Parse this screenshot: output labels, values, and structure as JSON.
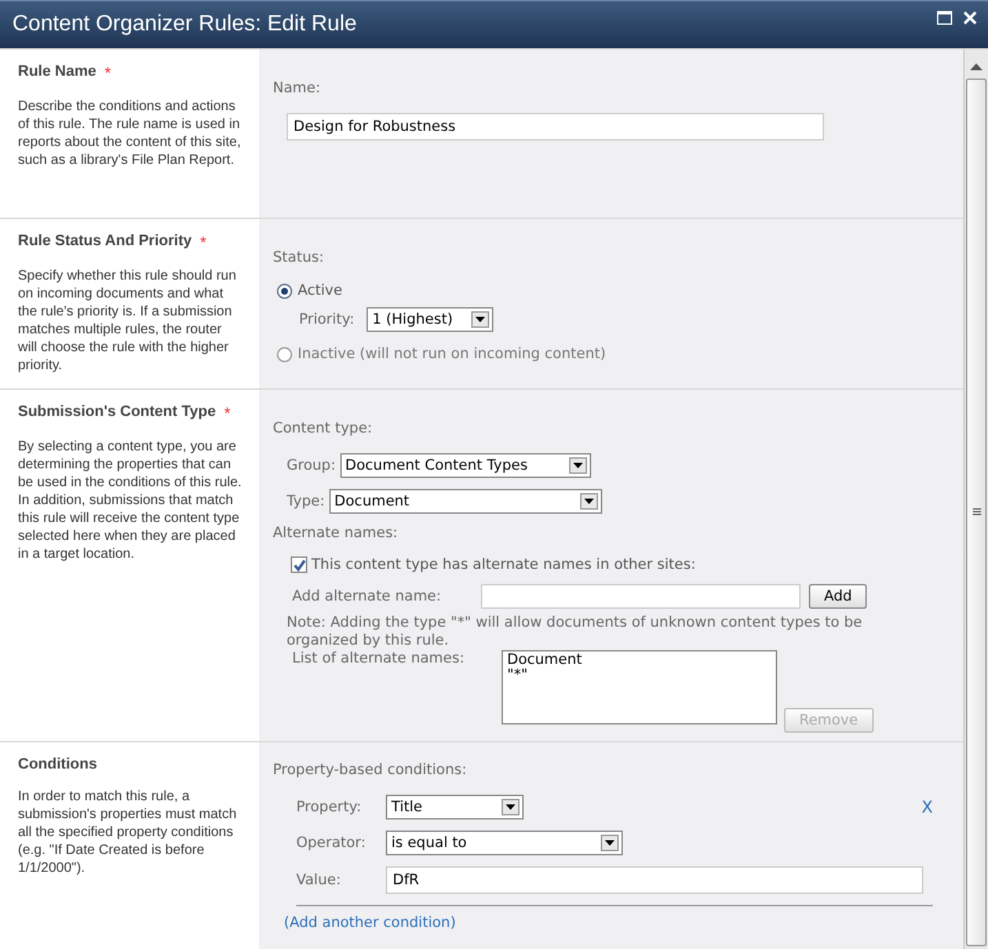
{
  "window": {
    "title": "Content Organizer Rules: Edit Rule"
  },
  "sections": [
    {
      "kind": "name",
      "title": "Rule Name",
      "required_mark": "*",
      "description": "Describe the conditions and actions of this rule. The rule name is used in reports about the content of this site, such as a library's File Plan Report.",
      "label": "Name:",
      "value": "Design for Robustness"
    },
    {
      "kind": "status",
      "title": "Rule Status And Priority",
      "required_mark": "*",
      "description": "Specify whether this rule should run on incoming documents and what the rule's priority is. If a submission matches multiple rules, the router will choose the rule with the higher priority.",
      "label": "Status:",
      "options": [
        {
          "label": "Active",
          "selected": true
        },
        {
          "label": "Inactive (will not run on incoming content)",
          "selected": false
        }
      ],
      "priority_label": "Priority:",
      "priority_value": "1 (Highest)"
    },
    {
      "kind": "content_type",
      "title": "Submission's Content Type",
      "required_mark": "*",
      "description": "By selecting a content type, you are determining the properties that can be used in the conditions of this rule. In addition, submissions that match this rule will receive the content type selected here when they are placed in a target location.",
      "label": "Content type:",
      "group_label": "Group:",
      "group_value": "Document Content Types",
      "type_label": "Type:",
      "type_value": "Document",
      "alternate_label": "Alternate names:",
      "alternate_checkbox": {
        "label": "This content type has alternate names in other sites:",
        "checked": true
      },
      "add_label": "Add alternate name:",
      "add_button": "Add",
      "note": "Note: Adding the type \"*\" will allow documents of unknown content types to be organized by this rule.",
      "list_label": "List of alternate names:",
      "alternate_names": [
        "Document",
        "\"*\""
      ],
      "remove_button": {
        "label": "Remove",
        "disabled": true
      }
    },
    {
      "kind": "conditions",
      "title": "Conditions",
      "description": "In order to match this rule, a submission's properties must match all the specified property conditions (e.g. \"If Date Created is before 1/1/2000\").",
      "label": "Property-based conditions:",
      "property_label": "Property:",
      "property_value": "Title",
      "operator_label": "Operator:",
      "operator_value": "is equal to",
      "value_label": "Value:",
      "value": "DfR",
      "remove_link": "X",
      "add_link": "(Add another condition)"
    }
  ]
}
